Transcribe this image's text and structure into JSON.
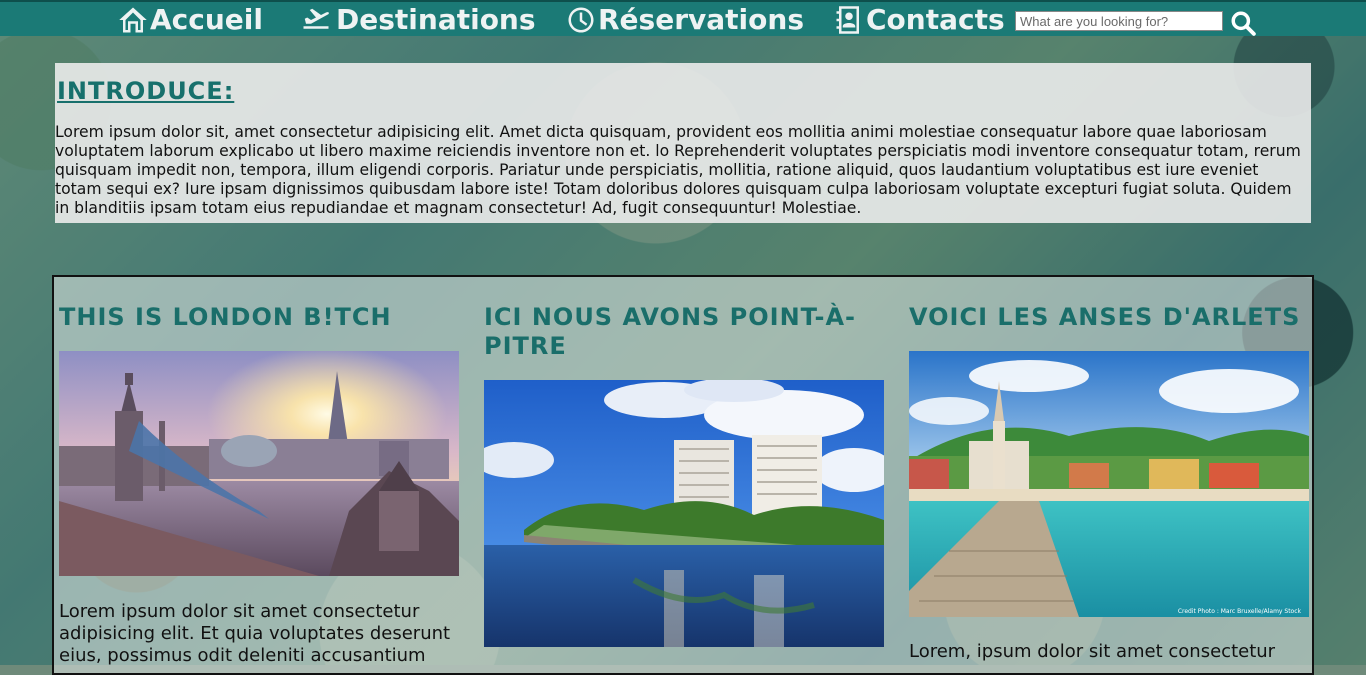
{
  "nav": {
    "items": [
      {
        "label": "Accueil",
        "icon": "home-icon"
      },
      {
        "label": "Destinations",
        "icon": "plane-icon"
      },
      {
        "label": "Réservations",
        "icon": "clock-icon"
      },
      {
        "label": "Contacts",
        "icon": "contact-card-icon"
      }
    ],
    "search_placeholder": "What are you looking for?",
    "search_icon": "search-icon",
    "bar_color": "#1b7a76"
  },
  "intro": {
    "title": "INTRODUCE:",
    "text": "Lorem ipsum dolor sit, amet consectetur adipisicing elit. Amet dicta quisquam, provident eos mollitia animi molestiae consequatur labore quae laboriosam voluptatem laborum explicabo ut libero maxime reiciendis inventore non et. lo Reprehenderit voluptates perspiciatis modi inventore consequatur totam, rerum quisquam impedit non, tempora, illum eligendi corporis. Pariatur unde perspiciatis, mollitia, ratione aliquid, quos laudantium voluptatibus est iure eveniet totam sequi ex? Iure ipsam dignissimos quibusdam labore iste! Totam doloribus dolores quisquam culpa laboriosam voluptate excepturi fugiat soluta. Quidem in blanditiis ipsam totam eius repudiandae et magnam consectetur! Ad, fugit consequuntur! Molestiae."
  },
  "destinations": [
    {
      "title": "THIS IS LONDON B!TCH",
      "text": "Lorem ipsum dolor sit amet consectetur adipisicing elit. Et quia voluptates deserunt eius, possimus odit deleniti accusantium"
    },
    {
      "title": "ICI NOUS AVONS POINT-À-PITRE",
      "text": ""
    },
    {
      "title": "VOICI LES ANSES D'ARLETS",
      "text": "Lorem, ipsum dolor sit amet consectetur",
      "photo_credit": "Credit Photo : Marc Bruxelle/Alamy Stock"
    }
  ],
  "colors": {
    "accent": "#1a6e6a",
    "nav": "#1b7a76"
  }
}
